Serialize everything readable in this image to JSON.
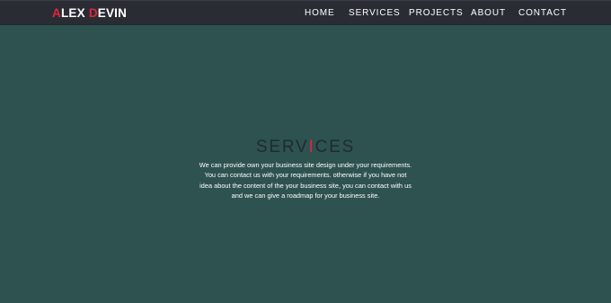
{
  "brand": {
    "first_initial": "A",
    "first_rest": "LEX",
    "last_initial": "D",
    "last_rest": "EVIN"
  },
  "nav": {
    "home": "HOME",
    "services": "SERVICES",
    "projects": "PROJECTS",
    "about": "ABOUT",
    "contact": "CONTACT"
  },
  "services_section": {
    "title_before": "SERV",
    "title_accent": "I",
    "title_after": "CES",
    "description": "We can provide own your business site design under your requirements. You can contact us with your requirements. otherwise if you have not idea about the content of the your business site, you can contact with us and we can give a roadmap for your business site."
  },
  "colors": {
    "page_background": "#2e524f",
    "navbar_background": "#292d33",
    "accent": "#e3243b",
    "title_text": "#1f2b2e",
    "body_text": "#ffffff"
  }
}
